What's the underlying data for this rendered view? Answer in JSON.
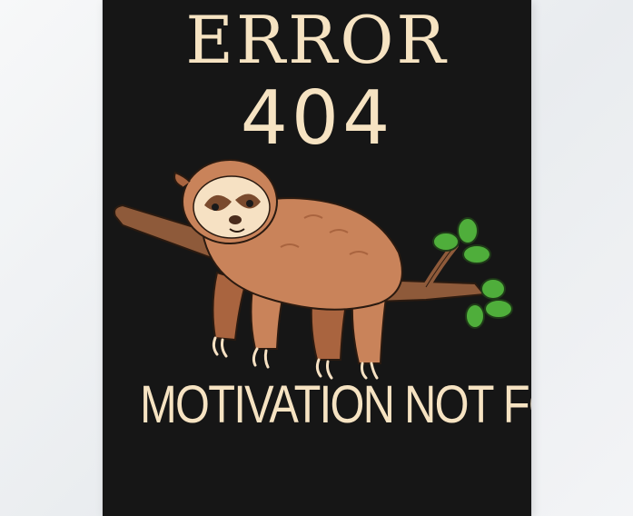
{
  "poster": {
    "heading": "ERROR",
    "code": "404",
    "tagline": "MOTIVATION NOT FOUND"
  },
  "illustration": {
    "subject": "sloth-on-branch",
    "colors": {
      "background": "#161616",
      "text": "#f6e3c2",
      "fur": "#c9835a",
      "fur_dark": "#a9643f",
      "face": "#f6e1c3",
      "branch": "#8e5a3a",
      "leaf": "#4fae3b"
    }
  }
}
